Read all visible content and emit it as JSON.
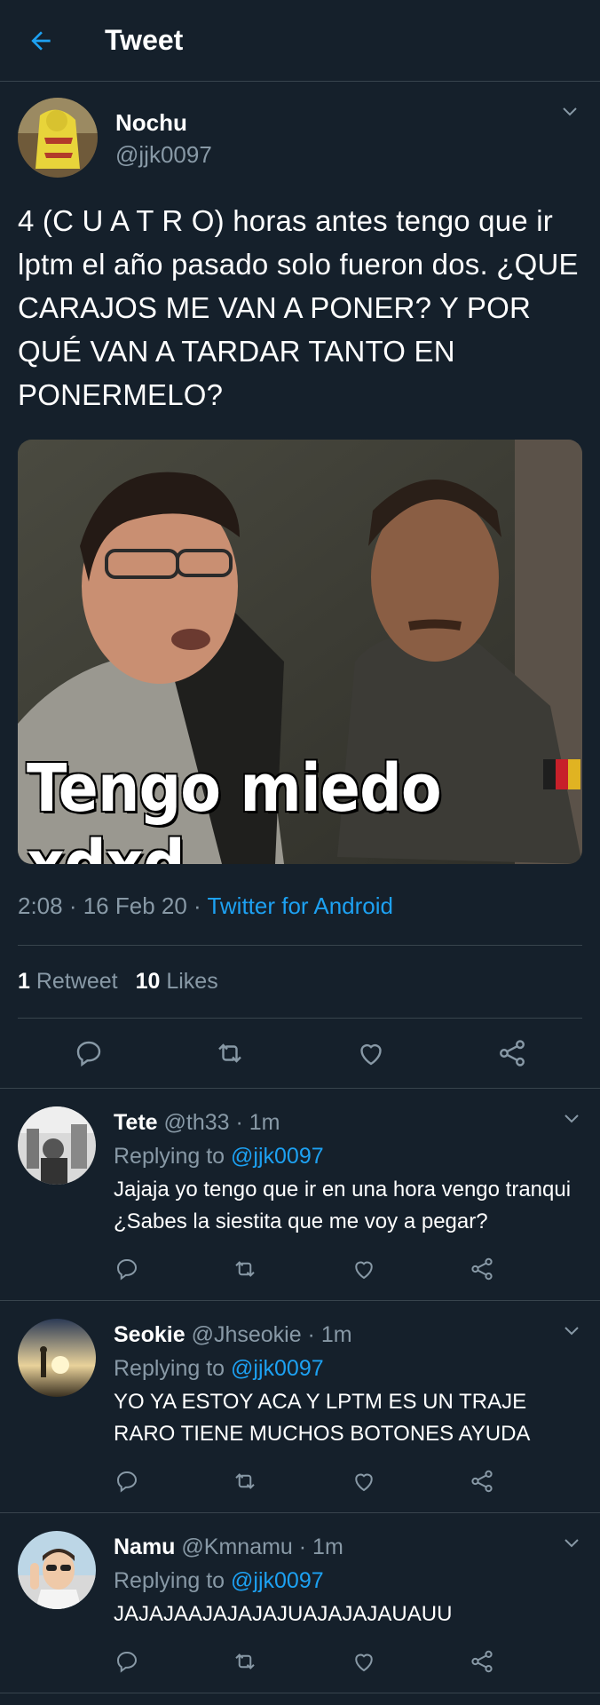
{
  "header": {
    "title": "Tweet"
  },
  "tweet": {
    "display_name": "Nochu",
    "handle": "@jjk0097",
    "text": "4 (C U A T R O) horas antes tengo que ir lptm el año pasado solo fueron dos. ¿QUE CARAJOS ME VAN A PONER? Y POR QUÉ VAN A TARDAR TANTO EN PONERMELO?",
    "media_caption": "Tengo miedo xdxd",
    "timestamp": "2:08 · 16 Feb 20 · ",
    "source": "Twitter for Android",
    "retweet_count": "1",
    "retweet_label": "Retweet",
    "like_count": "10",
    "like_label": "Likes"
  },
  "replies": [
    {
      "display_name": "Tete",
      "handle_time": "@th33 · 1m",
      "replying_label": "Replying to ",
      "mention": "@jjk0097",
      "text": "Jajaja yo tengo que ir en una hora vengo tranqui ¿Sabes la siestita que me voy a pegar?"
    },
    {
      "display_name": "Seokie",
      "handle_time": "@Jhseokie · 1m",
      "replying_label": "Replying to ",
      "mention": "@jjk0097",
      "text": "YO YA ESTOY ACA Y LPTM ES UN TRAJE RARO TIENE MUCHOS BOTONES AYUDA"
    },
    {
      "display_name": "Namu",
      "handle_time": "@Kmnamu · 1m",
      "replying_label": "Replying to ",
      "mention": "@jjk0097",
      "text": "JAJAJAAJAJAJAJUAJAJAJAUAUU"
    }
  ],
  "colors": {
    "background": "#15202b",
    "accent": "#1da1f2",
    "muted": "#8899a6",
    "divider": "#38444d"
  },
  "icons": [
    "back-arrow-icon",
    "chevron-down-icon",
    "reply-icon",
    "retweet-icon",
    "like-icon",
    "share-icon"
  ]
}
